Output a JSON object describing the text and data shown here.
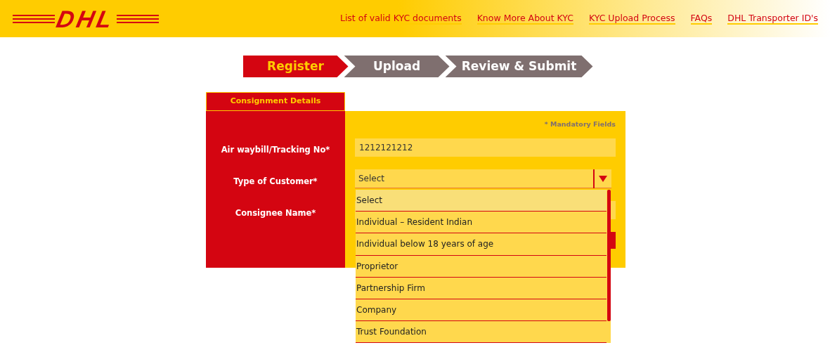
{
  "header": {
    "logo": "DHL",
    "links": [
      "List of valid KYC documents",
      "Know More About KYC",
      "KYC Upload Process",
      "FAQs",
      "DHL Transporter ID's"
    ]
  },
  "steps": [
    {
      "label": "Register",
      "selected": true
    },
    {
      "label": "Upload",
      "selected": false
    },
    {
      "label": "Review & Submit",
      "selected": false
    }
  ],
  "form": {
    "tab": "Consignment Details",
    "mandatory_note": "* Mandatory Fields",
    "fields": [
      {
        "label": "Air waybill/Tracking No*",
        "kind": "text",
        "value": "1212121212"
      },
      {
        "label": "Type of Customer*",
        "kind": "select",
        "value": "Select",
        "expanded": true,
        "options": [
          {
            "label": "Select",
            "selected": true
          },
          {
            "label": "Individual – Resident Indian",
            "selected": false
          },
          {
            "label": "Individual below 18 years of age",
            "selected": false
          },
          {
            "label": "Proprietor",
            "selected": false
          },
          {
            "label": "Partnership Firm",
            "selected": false
          },
          {
            "label": "Company",
            "selected": false
          },
          {
            "label": "Trust Foundation",
            "selected": false
          }
        ]
      },
      {
        "label": "Consignee Name*",
        "kind": "text"
      }
    ]
  }
}
